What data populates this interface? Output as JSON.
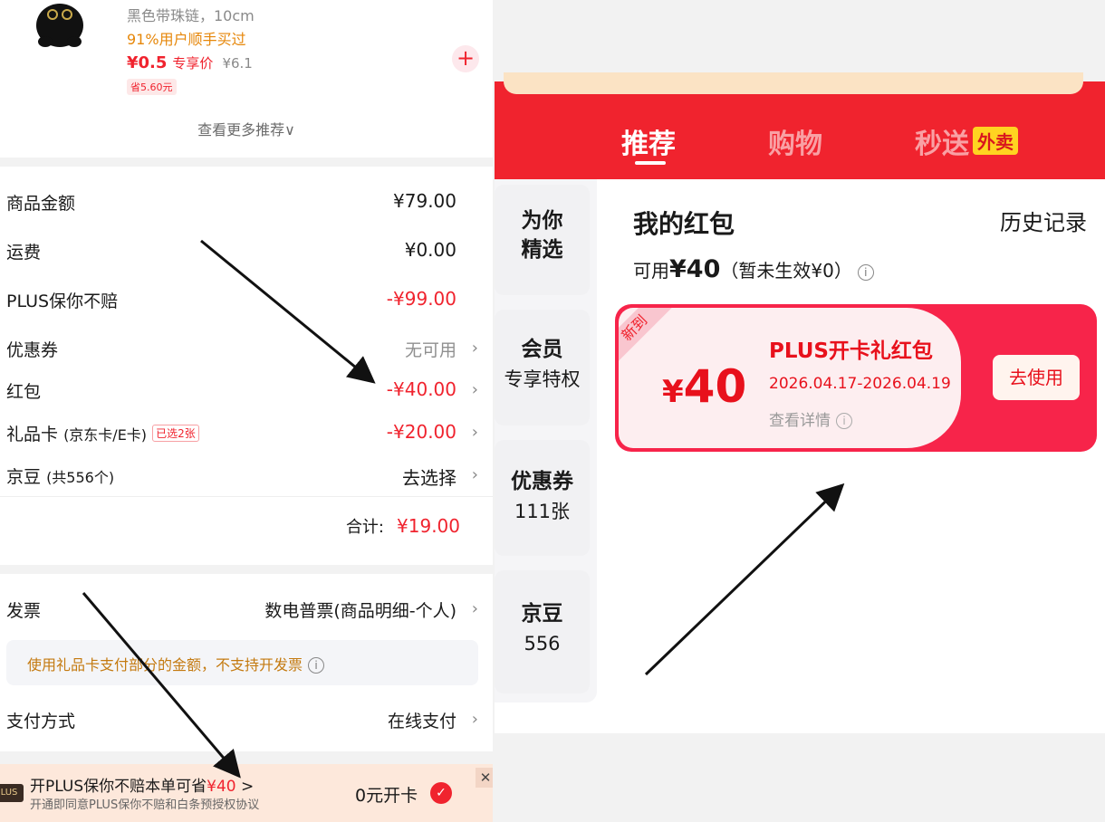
{
  "product": {
    "desc": "黑色带珠链，10cm",
    "tag": "91%用户顺手买过",
    "price": "¥0.5",
    "price_label": "专享价",
    "orig_price": "¥6.1",
    "save": "省5.60元",
    "add_symbol": "+",
    "more": "查看更多推荐∨"
  },
  "fees": {
    "goods_label": "商品金额",
    "goods_val": "¥79.00",
    "ship_label": "运费",
    "ship_val": "¥0.00",
    "plus_label": "PLUS保你不赔",
    "plus_val": "-¥99.00",
    "coupon_label": "优惠券",
    "coupon_val": "无可用",
    "redpack_label": "红包",
    "redpack_val": "-¥40.00",
    "gift_label": "礼品卡",
    "gift_paren": "(京东卡/E卡)",
    "gift_badge": "已选2张",
    "gift_val": "-¥20.00",
    "bean_label": "京豆",
    "bean_paren": "(共556个)",
    "bean_val": "去选择",
    "total_label": "合计:",
    "total_val": "¥19.00"
  },
  "invoice": {
    "label": "发票",
    "val": "数电普票(商品明细-个人)",
    "note": "使用礼品卡支付部分的金额，不支持开发票",
    "pay_label": "支付方式",
    "pay_val": "在线支付"
  },
  "plus_bar": {
    "logo": "LUS",
    "main": "开PLUS保你不赔本单可省",
    "main_amt": "¥40",
    "main_arrow": ">",
    "sub": "开通即同意PLUS保你不赔和白条预授权协议",
    "cta": "0元开卡",
    "check": "✓",
    "close": "✕"
  },
  "right": {
    "tabs": [
      "推荐",
      "购物",
      "秒送"
    ],
    "waimai": "外卖",
    "side": [
      {
        "t1": "为你",
        "t2": "精选"
      },
      {
        "t1": "会员",
        "t2": "专享特权"
      },
      {
        "t1": "优惠券",
        "t2": "111张"
      },
      {
        "t1": "京豆",
        "t2": "556"
      }
    ],
    "title": "我的红包",
    "history": "历史记录",
    "avail_prefix": "可用",
    "avail_amt": "¥40",
    "avail_suffix": "（暂未生效¥0）",
    "coupon": {
      "new_tag": "新到",
      "currency": "¥",
      "amount": "40",
      "name": "PLUS开卡礼红包",
      "date": "2026.04.17-2026.04.19",
      "detail": "查看详情",
      "use": "去使用"
    }
  },
  "colors": {
    "accent_red": "#f0232e",
    "orange_text": "#e6870a",
    "plus_bar_bg": "#fde8db"
  }
}
